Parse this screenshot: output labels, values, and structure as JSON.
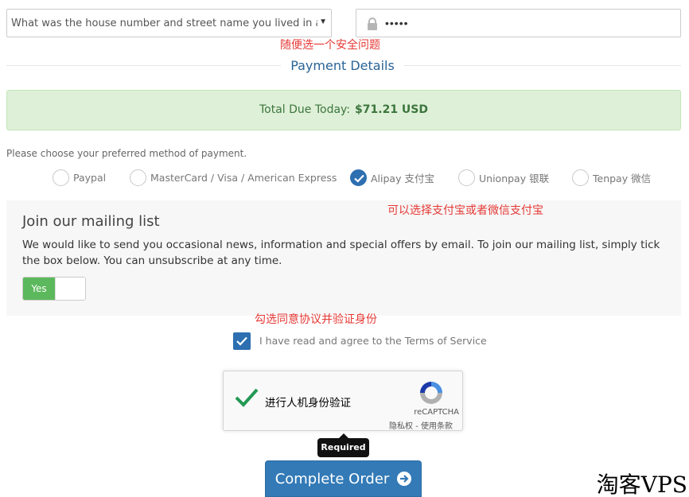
{
  "security": {
    "question_value": "What was the house number and street name you lived in as a child?",
    "answer_value": "•••••"
  },
  "annotations": {
    "security_note": "随便选一个安全问题",
    "payment_note": "可以选择支付宝或者微信支付宝",
    "agree_note": "勾选同意协议并验证身份"
  },
  "payment": {
    "section_title": "Payment Details",
    "total_label": "Total Due Today:",
    "total_amount": "$71.21 USD",
    "choose_prompt": "Please choose your preferred method of payment.",
    "methods": [
      {
        "label": "Paypal",
        "checked": false
      },
      {
        "label": "MasterCard / Visa / American Express",
        "checked": false
      },
      {
        "label": "Alipay 支付宝",
        "checked": true
      },
      {
        "label": "Unionpay 银联",
        "checked": false
      },
      {
        "label": "Tenpay 微信",
        "checked": false
      }
    ]
  },
  "mailing": {
    "title": "Join our mailing list",
    "description": "We would like to send you occasional news, information and special offers by email. To join our mailing list, simply tick the box below. You can unsubscribe at any time.",
    "toggle_label": "Yes"
  },
  "tos": {
    "label": "I have read and agree to the Terms of Service",
    "checked": true
  },
  "recaptcha": {
    "label": "进行人机身份验证",
    "brand": "reCAPTCHA",
    "terms": "隐私权 - 使用条款"
  },
  "tooltip": {
    "text": "Required"
  },
  "submit": {
    "label": "Complete Order"
  },
  "watermark": {
    "text": "淘客VPS"
  },
  "colors": {
    "primary": "#337ab7",
    "success_bg": "#dff0d8",
    "success_text": "#3c763d",
    "annotation_red": "#e53935",
    "toggle_green": "#5cb85c"
  }
}
